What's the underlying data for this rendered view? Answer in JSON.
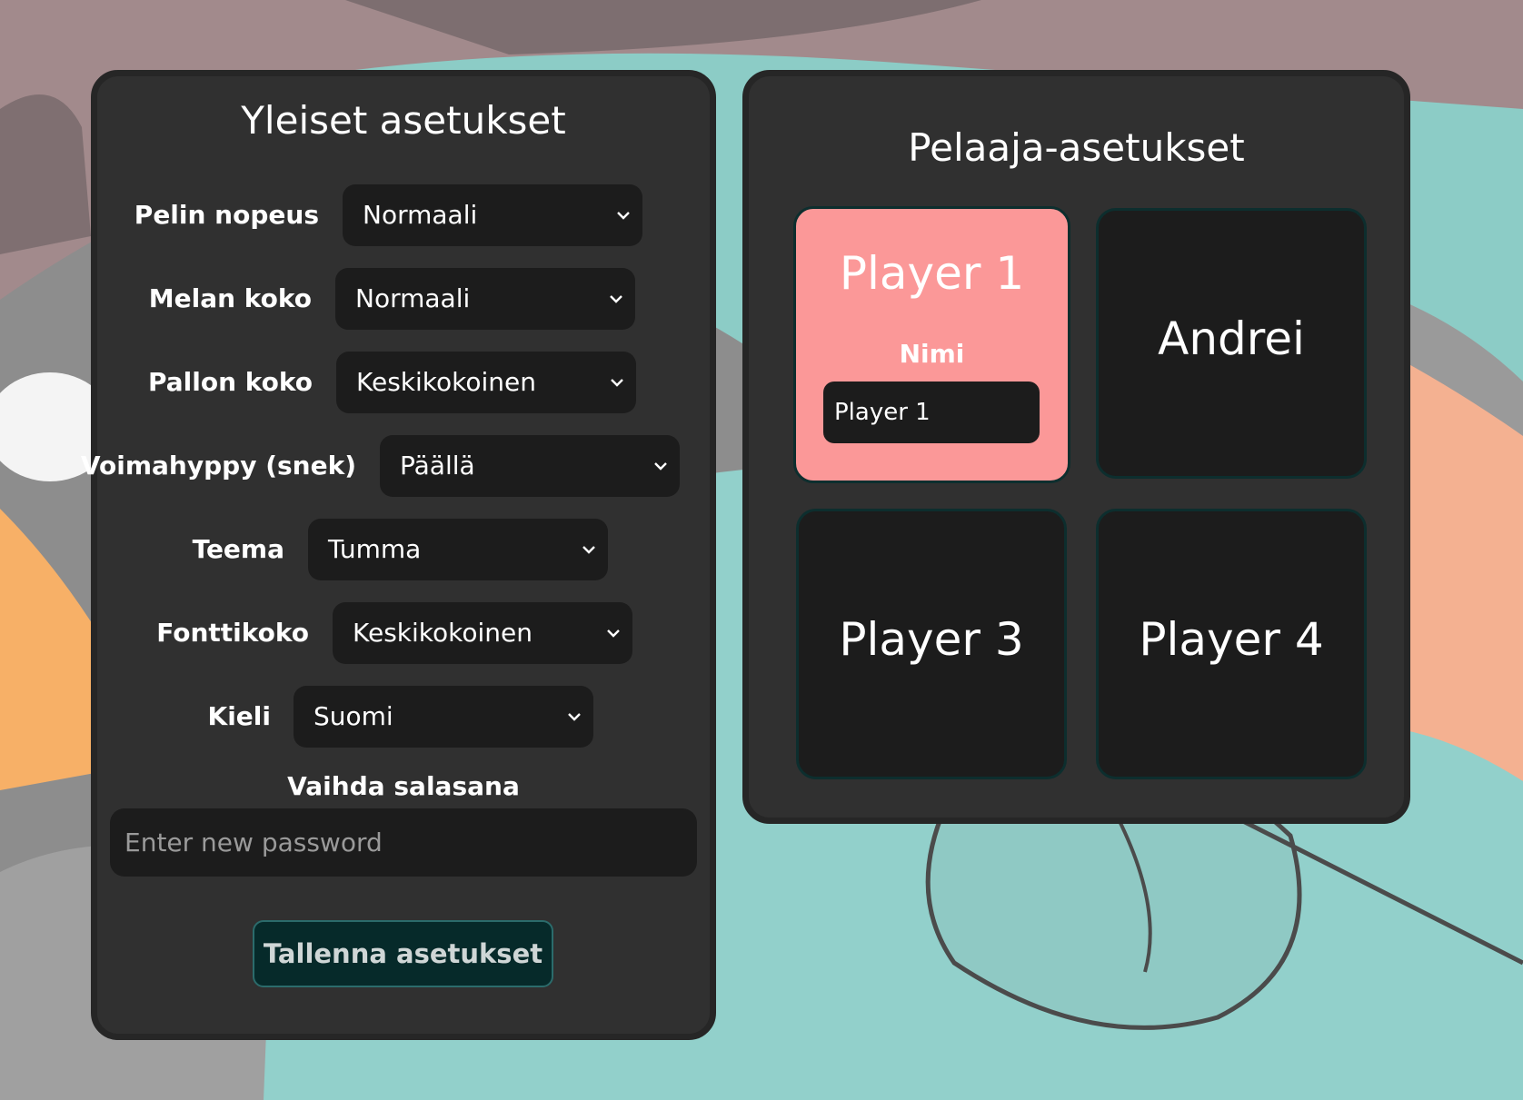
{
  "general": {
    "title": "Yleiset asetukset",
    "settings": [
      {
        "label": "Pelin nopeus",
        "value": "Normaali"
      },
      {
        "label": "Melan koko",
        "value": "Normaali"
      },
      {
        "label": "Pallon koko",
        "value": "Keskikokoinen"
      },
      {
        "label": "Voimahyppy (snek)",
        "value": "Päällä"
      },
      {
        "label": "Teema",
        "value": "Tumma"
      },
      {
        "label": "Fonttikoko",
        "value": "Keskikokoinen"
      },
      {
        "label": "Kieli",
        "value": "Suomi"
      }
    ],
    "password_label": "Vaihda salasana",
    "password_placeholder": "Enter new password",
    "save_label": "Tallenna asetukset"
  },
  "players": {
    "title": "Pelaaja-asetukset",
    "cards": [
      {
        "name": "Player 1",
        "field_label": "Nimi",
        "field_value": "Player 1"
      },
      {
        "name": "Andrei"
      },
      {
        "name": "Player 3"
      },
      {
        "name": "Player 4"
      }
    ]
  },
  "colors": {
    "panel_bg": "#303030",
    "control_bg": "#1c1c1c",
    "active_card": "#fb9898",
    "save_button_bg": "#062a2a"
  },
  "icons": {
    "dropdown": "chevron-down-icon"
  }
}
